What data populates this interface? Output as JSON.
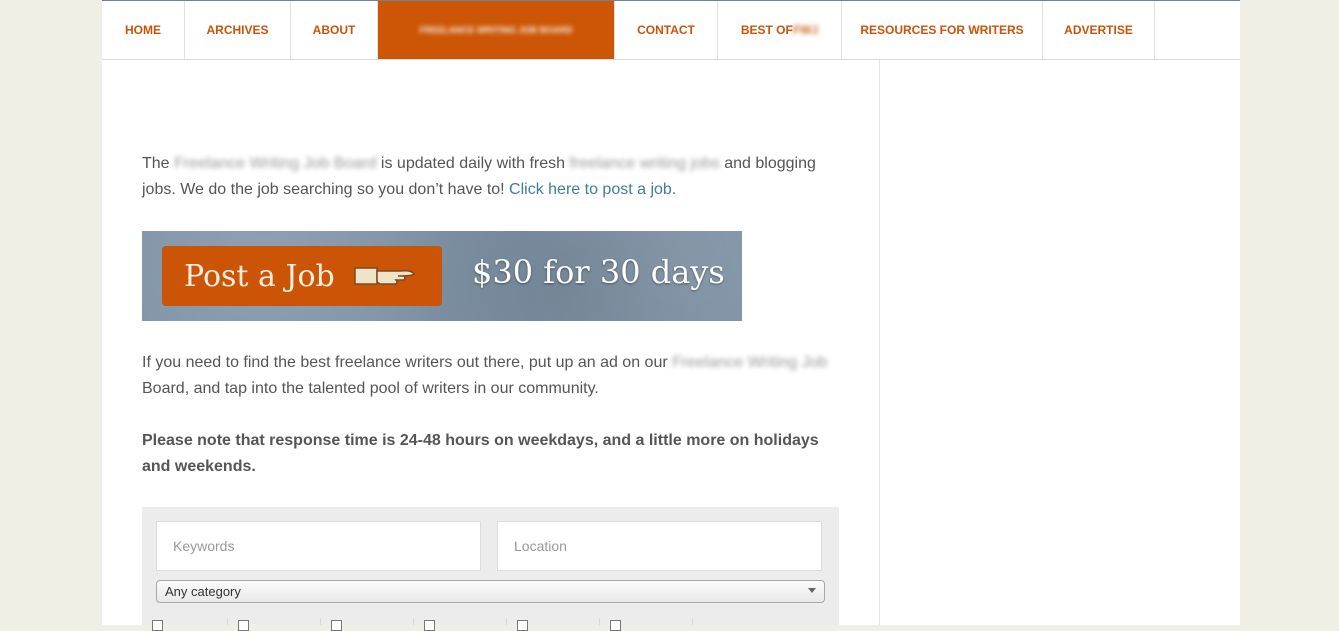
{
  "nav": {
    "items": [
      {
        "label": "HOME",
        "active": false
      },
      {
        "label": "ARCHIVES",
        "active": false
      },
      {
        "label": "ABOUT",
        "active": false
      },
      {
        "label": "FREELANCE WRITING JOB BOARD",
        "active": true,
        "blurred": true
      },
      {
        "label": "CONTACT",
        "active": false
      },
      {
        "label": "BEST OF",
        "suffix": "FWJ",
        "active": false
      },
      {
        "label": "RESOURCES FOR WRITERS",
        "active": false
      },
      {
        "label": "ADVERTISE",
        "active": false
      }
    ]
  },
  "intro": {
    "text_1": "The ",
    "blur_1": "Freelance Writing Job Board",
    "text_2": " is updated daily with fresh ",
    "blur_2": "freelance writing jobs",
    "text_3": " and blogging jobs. We do the job searching so you don’t have to! ",
    "link": "Click here to post a job."
  },
  "banner": {
    "button_label": "Post a Job",
    "price": "$30 for 30 days",
    "icon": "pointing-hand-icon"
  },
  "paragraph2": {
    "text_1": "If you need to find the best freelance writers out there, put up an ad on our ",
    "blur": "Freelance Writing Job",
    "text_2": " Board, and tap into the talented pool of writers in our community."
  },
  "notice": "Please note that response time is 24-48 hours on weekdays, and a little more on holidays and weekends.",
  "search": {
    "keywords_placeholder": "Keywords",
    "location_placeholder": "Location",
    "category_selected": "Any category",
    "job_types": [
      "",
      "",
      "",
      "",
      "",
      ""
    ]
  },
  "colors": {
    "accent": "#cc5606",
    "link": "#3d7f9a",
    "page_bg": "#f0efe6"
  }
}
